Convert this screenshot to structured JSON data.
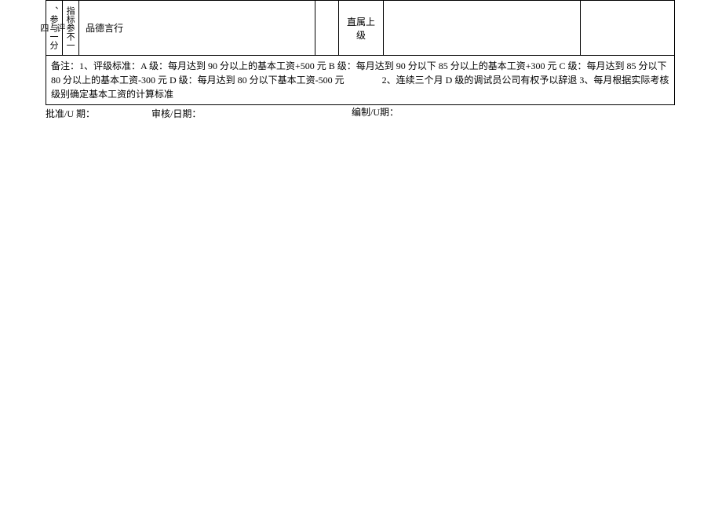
{
  "table": {
    "row1": {
      "col1_lines": "、参与一分四",
      "col2_lines": "指标参不一评",
      "col3": "品德言行",
      "col4": "",
      "col5": "直属上级",
      "col6": "",
      "col7": ""
    },
    "remarks": "备注：1、评级标准：A 级：每月达到 90 分以上的基本工资+500 元 B 级：每月达到 90 分以下 85 分以上的基本工资+300 元 C 级：每月达到 85 分以下 80 分以上的基本工资-300 元 D 级：每月达到 80 分以下基本工资-500 元    2、连续三个月 D 级的调试员公司有权予以辞退 3、每月根据实际考核级别确定基本工资的计算标准"
  },
  "footer": {
    "approve": "批准/U 期：",
    "review": "审核/日期：",
    "compile": "编制/U期："
  }
}
